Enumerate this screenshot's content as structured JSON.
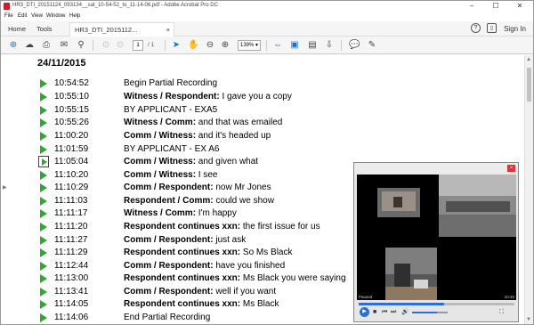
{
  "window": {
    "title": "HR3_DTI_20151124_093134__sat_10-54-52_to_11-14-06.pdf - Adobe Acrobat Pro DC",
    "controls": {
      "minimize": "–",
      "maximize": "☐",
      "close": "✕"
    }
  },
  "menu": [
    "File",
    "Edit",
    "View",
    "Window",
    "Help"
  ],
  "tabs": {
    "home": "Home",
    "tools": "Tools",
    "document": "HR3_DTI_2015112...",
    "close": "×",
    "help": "?",
    "signin": "Sign In"
  },
  "toolbar": {
    "page_current": "1",
    "page_total": "/ 1",
    "zoom": "139%",
    "icons": [
      "create-icon",
      "upload-icon",
      "print-icon",
      "mail-icon",
      "search-icon",
      "page-up-icon",
      "page-down-icon",
      "select-cursor-icon",
      "hand-icon",
      "zoom-out-icon",
      "zoom-in-icon",
      "fit-width-icon",
      "fit-page-icon",
      "scroll-mode-icon",
      "comment-icon",
      "pen-icon"
    ]
  },
  "document": {
    "date": "24/11/2015",
    "entries": [
      {
        "time": "10:54:52",
        "speaker": "",
        "text": "Begin Partial Recording"
      },
      {
        "time": "10:55:10",
        "speaker": "Witness / Respondent:",
        "text": " I gave you a copy"
      },
      {
        "time": "10:55:15",
        "speaker": "",
        "text": "BY APPLICANT -  EXA5"
      },
      {
        "time": "10:55:26",
        "speaker": "Witness / Comm:",
        "text": " and that was emailed"
      },
      {
        "time": "11:00:20",
        "speaker": "Comm / Witness:",
        "text": " and it's headed up"
      },
      {
        "time": "11:01:59",
        "speaker": "",
        "text": "BY APPLICANT - EX A6"
      },
      {
        "time": "11:05:04",
        "speaker": "Comm / Witness:",
        "text": " and given what"
      },
      {
        "time": "11:10:20",
        "speaker": "Comm / Witness:",
        "text": " I see"
      },
      {
        "time": "11:10:29",
        "speaker": "Comm / Respondent:",
        "text": " now Mr Jones"
      },
      {
        "time": "11:11:03",
        "speaker": "Respondent / Comm:",
        "text": " could we show"
      },
      {
        "time": "11:11:17",
        "speaker": "Witness / Comm:",
        "text": " I'm happy"
      },
      {
        "time": "11:11:20",
        "speaker": "Respondent continues xxn:",
        "text": " the first issue for us"
      },
      {
        "time": "11:11:27",
        "speaker": "Comm / Respondent:",
        "text": " just ask"
      },
      {
        "time": "11:11:29",
        "speaker": "Respondent continues xxn:",
        "text": " So Ms Black"
      },
      {
        "time": "11:12:44",
        "speaker": "Comm / Respondent:",
        "text": " have you finished"
      },
      {
        "time": "11:13:00",
        "speaker": "Respondent continues xxn:",
        "text": " Ms Black you were saying"
      },
      {
        "time": "11:13:41",
        "speaker": "Comm / Respondent:",
        "text": " well if you want"
      },
      {
        "time": "11:14:05",
        "speaker": "Respondent continues xxn:",
        "text": " Ms Black"
      },
      {
        "time": "11:14:06",
        "speaker": "",
        "text": "End Partial Recording"
      }
    ]
  },
  "player": {
    "status": "Paused",
    "time": "10:45",
    "progress": 0.55,
    "volume": 0.7,
    "close": "×"
  },
  "colors": {
    "play_green": "#2ea82e",
    "accent_blue": "#1a73c9",
    "acrobat_red": "#c8202a"
  }
}
